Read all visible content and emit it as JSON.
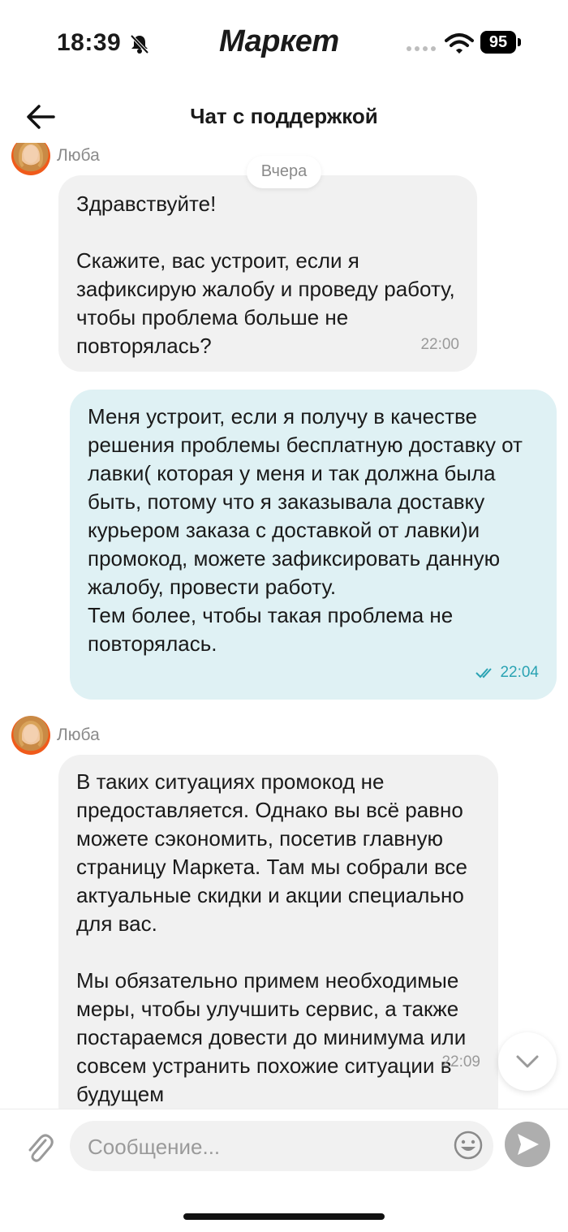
{
  "status_bar": {
    "time": "18:39",
    "brand": "Маркет",
    "battery": "95"
  },
  "header": {
    "title": "Чат с поддержкой"
  },
  "chat": {
    "date_divider": "Вчера",
    "messages": [
      {
        "sender": "Люба",
        "text": "Здравствуйте!\n\nСкажите, вас устроит, если я зафиксирую жалобу и проведу работу, чтобы проблема больше не повторялась?",
        "time": "22:00",
        "direction": "incoming"
      },
      {
        "text": "Меня устроит, если я получу в качестве решения проблемы бесплатную доставку от лавки( которая у меня и так должна была быть, потому что я заказывала доставку курьером заказа с доставкой от лавки)и промокод, можете зафиксировать данную жалобу, провести работу.\nТем более, чтобы такая проблема не повторялась.",
        "time": "22:04",
        "direction": "outgoing",
        "read": true
      },
      {
        "sender": "Люба",
        "text": "В таких ситуациях промокод не предоставляется. Однако вы всё равно можете сэкономить, посетив главную страницу Маркета. Там мы собрали все актуальные скидки и акции специально для вас.\n\nМы обязательно примем необходимые меры, чтобы улучшить сервис, а также постараемся довести до минимума или совсем устранить похожие ситуации в будущем",
        "time": "22:09",
        "direction": "incoming"
      }
    ]
  },
  "composer": {
    "placeholder": "Сообщение..."
  },
  "icons": {
    "back": "arrow-left-icon",
    "mute": "bell-slash-icon",
    "attach": "paperclip-icon",
    "emoji": "smile-icon",
    "send": "send-icon",
    "scroll": "chevron-down-icon"
  },
  "colors": {
    "incoming_bubble": "#f1f1f1",
    "outgoing_bubble": "#dff1f4",
    "read_tick": "#2aa3b3",
    "send_button": "#aeaeae"
  }
}
